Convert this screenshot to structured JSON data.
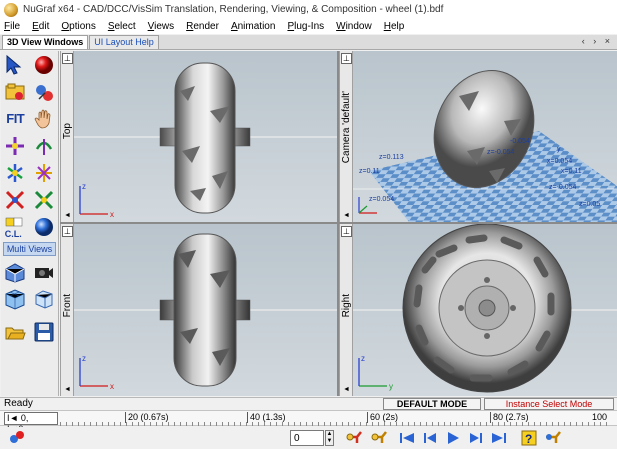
{
  "window": {
    "title": "NuGraf x64 - CAD/DCC/VisSim Translation, Rendering, Viewing, & Composition - wheel (1).bdf"
  },
  "menu": {
    "items": [
      "File",
      "Edit",
      "Options",
      "Select",
      "Views",
      "Render",
      "Animation",
      "Plug-Ins",
      "Window",
      "Help"
    ]
  },
  "tabs": {
    "items": [
      {
        "label": "3D View Windows",
        "active": true
      },
      {
        "label": "UI Layout Help",
        "active": false
      }
    ],
    "controls": "‹ › ×"
  },
  "toolbar": {
    "fit_label": "FIT",
    "multi_views_label": "Multi Views",
    "cl_label": "C.L."
  },
  "viewports": {
    "top_label": "Top",
    "front_label": "Front",
    "camera_label": "Camera 'default'",
    "right_label": "Right",
    "axis_z": "z",
    "axis_x": "x",
    "axis_y": "y",
    "grid_labels": [
      "-0.054",
      "z=-0.054",
      "x=0.054",
      "z=0.113",
      "z=0.11",
      "x=0.11",
      "z=0.054",
      "z=-0.054",
      "z=0.05",
      "y"
    ]
  },
  "status": {
    "ready": "Ready",
    "mode": "DEFAULT MODE",
    "select_mode": "Instance Select Mode"
  },
  "timeline": {
    "current": "I◄ 0, I◄0sec",
    "labels": [
      "20 (0.67s)",
      "40 (1.3s)",
      "60 (2s)",
      "80 (2.7s)",
      "100"
    ]
  },
  "controls": {
    "frame_value": "0"
  },
  "colors": {
    "accent": "#1b3fa0",
    "alert": "#c00000",
    "viewport_bg": "#c6cfd5",
    "grid": "#4f86c6"
  }
}
